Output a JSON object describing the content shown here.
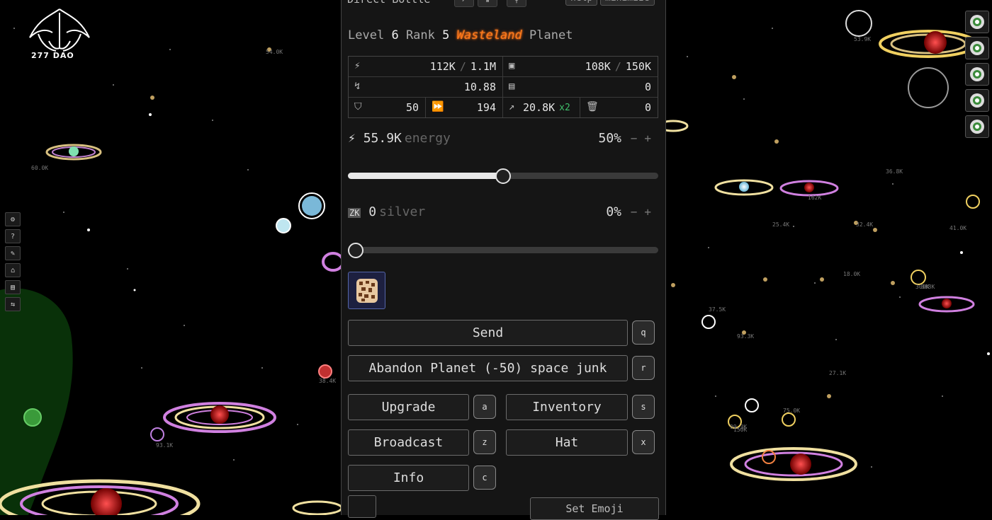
{
  "brand": {
    "logo_text": "277 DAO"
  },
  "panel": {
    "title": "Direct Bottle",
    "help_label": "help",
    "minimize_label": "minimize",
    "planet": {
      "level_label": "Level",
      "level": "6",
      "rank_label": "Rank",
      "rank": "5",
      "biome": "Wasteland",
      "type_word": "Planet"
    },
    "stats": {
      "energy": "112K",
      "energy_cap": "1.1M",
      "silver": "108K",
      "silver_cap": "150K",
      "energy_growth": "10.88",
      "silver_growth": "0",
      "defense": "50",
      "speed": "194",
      "range": "20.8K",
      "range_mult": "x2",
      "junk": "0"
    },
    "energy_send": {
      "amount": "55.9K",
      "label": "energy",
      "percent": "50%",
      "minus": "−",
      "plus": "+",
      "fraction": 0.5
    },
    "silver_send": {
      "amount": "0",
      "label": "silver",
      "percent": "0%",
      "minus": "−",
      "plus": "+",
      "fraction": 0.0
    },
    "buttons": {
      "send": "Send",
      "send_key": "q",
      "abandon": "Abandon Planet (-50) space junk",
      "abandon_key": "r",
      "upgrade": "Upgrade",
      "upgrade_key": "a",
      "inventory": "Inventory",
      "inventory_key": "s",
      "broadcast": "Broadcast",
      "broadcast_key": "z",
      "hat": "Hat",
      "hat_key": "x",
      "info": "Info",
      "info_key": "c",
      "set_emoji": "Set Emoji"
    }
  },
  "map_labels": [
    "150K",
    "37.5K",
    "93.3K",
    "54.0K",
    "36.8K",
    "41.0K",
    "18.0K",
    "75.0K",
    "99.3K",
    "162K",
    "93.1K",
    "388K",
    "300K",
    "32.4K",
    "25.4K",
    "38.4K",
    "53.9K",
    "60.0K",
    "27.1K"
  ],
  "icons": {
    "left_toolbar": [
      "gear-icon",
      "help-icon",
      "pen-icon",
      "gift-icon",
      "save-icon",
      "swap-icon"
    ],
    "right_toolbar": [
      "planet-badge-icon",
      "planet-badge-icon",
      "planet-badge-icon",
      "planet-badge-icon",
      "planet-badge-icon"
    ]
  },
  "colors": {
    "accent_orange": "#ff7a1a",
    "mult_green": "#3fbf6a",
    "panel_bg": "#151515"
  }
}
